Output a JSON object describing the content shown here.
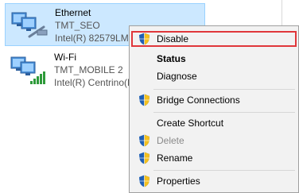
{
  "connections": [
    {
      "name": "Ethernet",
      "network": "TMT_SEO",
      "adapter": "Intel(R) 82579LM",
      "selected": true
    },
    {
      "name": "Wi-Fi",
      "network": "TMT_MOBILE  2",
      "adapter": "Intel(R) Centrino(R)",
      "selected": false
    }
  ],
  "context_menu": {
    "items": [
      {
        "label": "Disable",
        "shield": true,
        "highlighted": true
      },
      {
        "label": "Status",
        "bold": true
      },
      {
        "label": "Diagnose"
      },
      {
        "label": "Bridge Connections",
        "shield": true
      },
      {
        "label": "Create Shortcut"
      },
      {
        "label": "Delete",
        "shield": true,
        "disabled": true
      },
      {
        "label": "Rename",
        "shield": true
      },
      {
        "label": "Properties",
        "shield": true
      }
    ]
  },
  "colors": {
    "selection_bg": "#cce8ff",
    "highlight_border": "#e0373b",
    "menu_bg": "#f2f2f2",
    "shield_blue": "#1f5fb5",
    "shield_yellow": "#f4c01e"
  },
  "icons": {
    "ethernet": "network-adapter-monitors-icon",
    "wifi": "wifi-signal-bars-icon",
    "shield": "uac-shield-icon"
  }
}
